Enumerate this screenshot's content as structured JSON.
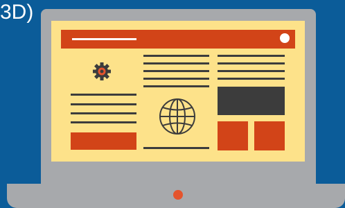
{
  "caption": {
    "text": "3D)"
  },
  "colors": {
    "background": "#0b5c99",
    "laptop_frame": "#a7a9ac",
    "screen": "#fde28a",
    "accent": "#d24418",
    "dark": "#3c3c3c",
    "indicator_light": "#e4542d"
  },
  "icons": {
    "left_column": "gear-icon",
    "center_column": "globe-icon"
  }
}
